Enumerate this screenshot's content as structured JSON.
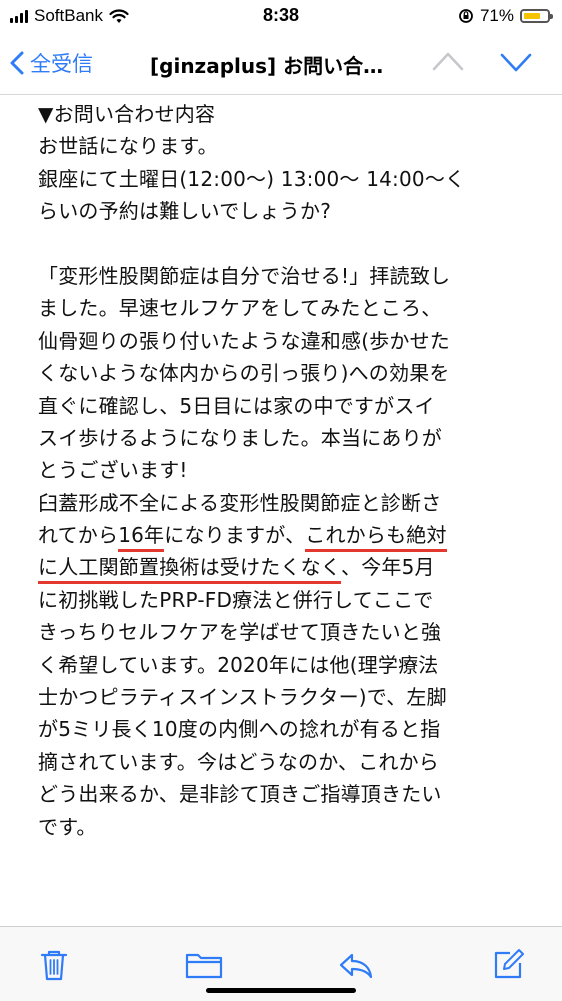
{
  "status_bar": {
    "carrier": "SoftBank",
    "time": "8:38",
    "battery": "71%",
    "battery_level": 0.71
  },
  "nav": {
    "back_label": "全受信",
    "title": "[ginzaplus] お問い合…"
  },
  "body_lines": [
    "▼お問い合わせ内容",
    "お世話になります。",
    "銀座にて土曜日(12:00〜) 13:00〜 14:00〜く",
    "らいの予約は難しいでしょうか?",
    "",
    "「変形性股関節症は自分で治せる!」拝読致し",
    "ました。早速セルフケアをしてみたところ、",
    "仙骨廻りの張り付いたような違和感(歩かせた",
    "くないような体内からの引っ張り)への効果を",
    "直ぐに確認し、5日目には家の中ですがスイ",
    "スイ歩けるようになりました。本当にありが",
    "とうございます!",
    "臼蓋形成不全による変形性股関節症と診断さ"
  ],
  "highlight_line1": {
    "a": "れてから",
    "b": "16年",
    "c": "になりますが、",
    "d": "これからも絶対"
  },
  "highlight_line2": {
    "a": "に人工関節置換術は受けたくなく",
    "b": "、今年5月"
  },
  "body_lines_after": [
    "に初挑戦したPRP-FD療法と併行してここで",
    "きっちりセルフケアを学ばせて頂きたいと強",
    "く希望しています。2020年には他(理学療法",
    "士かつピラティスインストラクター)で、左脚",
    "が5ミリ長く10度の内側への捻れが有ると指",
    "摘されています。今はどうなのか、これから",
    "どう出来るか、是非診て頂きご指導頂きたい",
    "です。"
  ],
  "colors": {
    "accent": "#2f7cf6",
    "underline": "#e2382e"
  },
  "toolbar": {
    "icons": [
      "trash-icon",
      "folder-icon",
      "reply-icon",
      "compose-icon"
    ]
  }
}
